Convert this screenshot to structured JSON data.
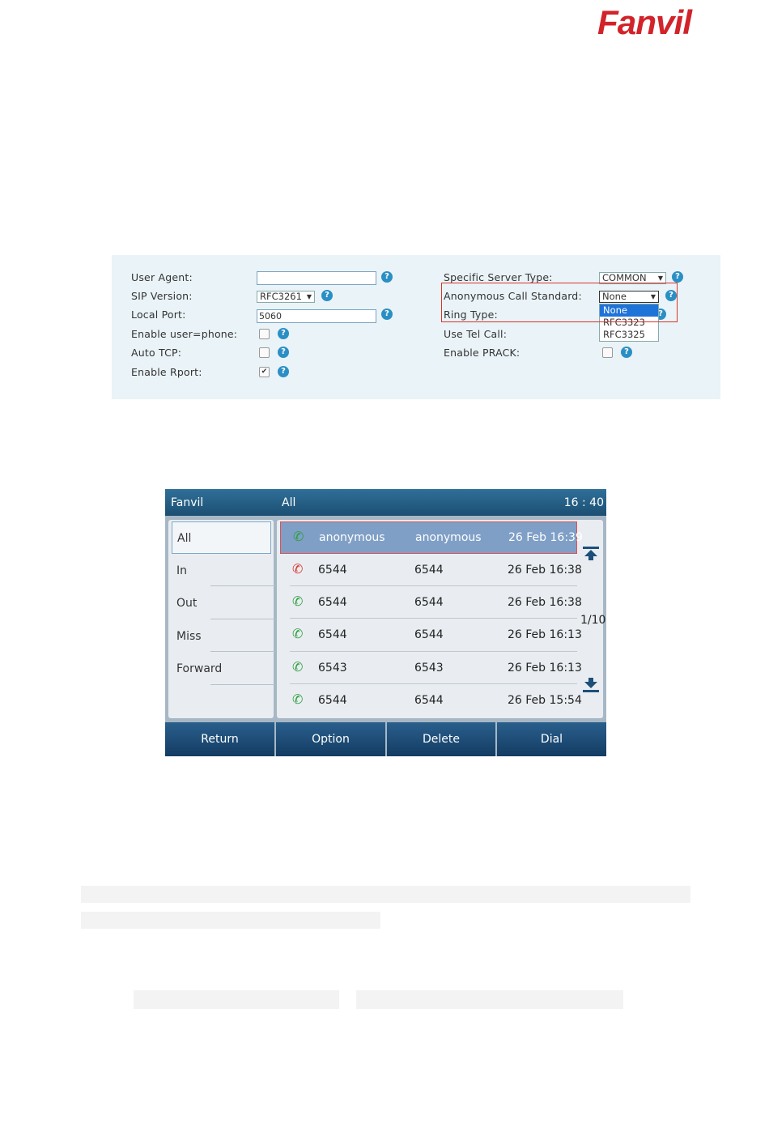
{
  "logo": {
    "text": "Fanvil",
    "color": "#d2232a"
  },
  "settings": {
    "left": [
      {
        "label": "User Agent:",
        "control": "text",
        "value": ""
      },
      {
        "label": "SIP Version:",
        "control": "select",
        "value": "RFC3261"
      },
      {
        "label": "Local Port:",
        "control": "text",
        "value": "5060"
      },
      {
        "label": "Enable user=phone:",
        "control": "checkbox",
        "checked": false
      },
      {
        "label": "Auto TCP:",
        "control": "checkbox",
        "checked": false
      },
      {
        "label": "Enable Rport:",
        "control": "checkbox",
        "checked": true
      }
    ],
    "right": [
      {
        "label": "Specific Server Type:",
        "control": "select",
        "value": "COMMON"
      },
      {
        "label": "Anonymous Call Standard:",
        "control": "select",
        "value": "None"
      },
      {
        "label": "Ring Type:",
        "control": "select"
      },
      {
        "label": "Use Tel Call:",
        "control": "checkbox"
      },
      {
        "label": "Enable PRACK:",
        "control": "checkbox",
        "checked": false
      }
    ],
    "anonymous_dropdown_options": [
      "None",
      "RFC3323",
      "RFC3325"
    ],
    "help_glyph": "?",
    "check_glyph": "✔",
    "dropdown_arrow": "▼"
  },
  "phone": {
    "title": "Fanvil",
    "screen_label": "All",
    "time": "16 : 40",
    "categories": [
      "All",
      "In",
      "Out",
      "Miss",
      "Forward"
    ],
    "calls": [
      {
        "icon": "incoming-call-icon",
        "color": "#2e9e3e",
        "name": "anonymous",
        "number": "anonymous",
        "time": "26 Feb 16:39"
      },
      {
        "icon": "missed-call-icon",
        "color": "#d9342b",
        "name": "6544",
        "number": "6544",
        "time": "26 Feb 16:38"
      },
      {
        "icon": "outgoing-call-icon",
        "color": "#2e9e3e",
        "name": "6544",
        "number": "6544",
        "time": "26 Feb 16:38"
      },
      {
        "icon": "incoming-call-icon",
        "color": "#2e9e3e",
        "name": "6544",
        "number": "6544",
        "time": "26 Feb 16:13"
      },
      {
        "icon": "incoming-call-icon",
        "color": "#2e9e3e",
        "name": "6543",
        "number": "6543",
        "time": "26 Feb 16:13"
      },
      {
        "icon": "incoming-call-icon",
        "color": "#2e9e3e",
        "name": "6544",
        "number": "6544",
        "time": "26 Feb 15:54"
      }
    ],
    "page_indicator": "1/10",
    "softkeys": [
      "Return",
      "Option",
      "Delete",
      "Dial"
    ]
  }
}
